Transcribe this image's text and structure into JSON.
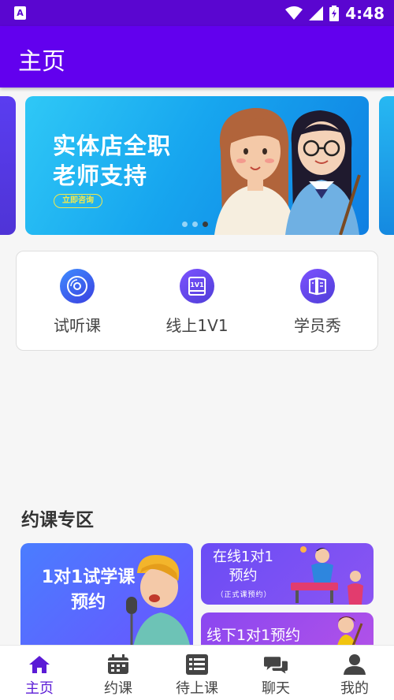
{
  "status_bar": {
    "time": "4:48"
  },
  "app_bar": {
    "title": "主页"
  },
  "banner": {
    "line1": "实体店全职",
    "line2": "老师支持",
    "button": "立即咨询"
  },
  "quick_actions": [
    {
      "label": "试听课",
      "icon": "disc-icon"
    },
    {
      "label": "线上1V1",
      "icon": "book-1v1-icon"
    },
    {
      "label": "学员秀",
      "icon": "sheet-music-icon"
    }
  ],
  "section": {
    "title": "约课专区"
  },
  "cards": {
    "big": {
      "line1": "1对1试学课",
      "line2": "预约"
    },
    "online": {
      "line1": "在线1对1",
      "line2": "预约",
      "sub": "（正式课预约）"
    },
    "offline": {
      "text": "线下1对1预约"
    }
  },
  "bottom_nav": [
    {
      "label": "主页",
      "icon": "home-icon",
      "active": true
    },
    {
      "label": "约课",
      "icon": "calendar-icon"
    },
    {
      "label": "待上课",
      "icon": "list-icon"
    },
    {
      "label": "聊天",
      "icon": "chat-icon"
    },
    {
      "label": "我的",
      "icon": "user-icon"
    }
  ],
  "colors": {
    "primary": "#6200ee",
    "status_bar": "#5a06d0",
    "active_tab": "#5b1bd6"
  }
}
